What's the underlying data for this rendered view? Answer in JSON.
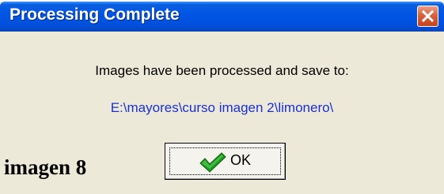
{
  "dialog": {
    "title": "Processing Complete",
    "message": "Images have been processed and save to:",
    "path": "E:\\mayores\\curso imagen 2\\limonero\\",
    "ok_label": "OK"
  },
  "caption": "imagen 8",
  "icons": {
    "close": "close-icon",
    "ok": "checkmark-icon"
  },
  "colors": {
    "titlebar": "#0054e3",
    "path_text": "#1a2fd6",
    "close_button": "#d9623e",
    "checkmark": "#1e9a1e"
  }
}
